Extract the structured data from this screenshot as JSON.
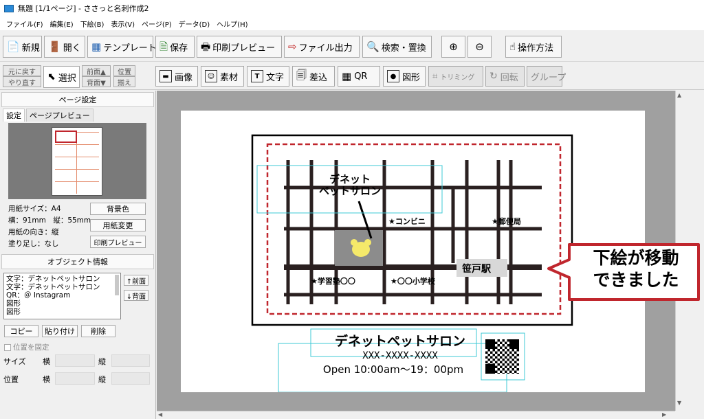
{
  "window": {
    "title": "無題 [1/1ページ] - ささっと名刺作成2"
  },
  "menu": [
    "ファイル(F)",
    "編集(E)",
    "下絵(B)",
    "表示(V)",
    "ページ(P)",
    "データ(D)",
    "ヘルプ(H)"
  ],
  "toolbar": {
    "new": "新規",
    "open": "開く",
    "template": "テンプレート",
    "save": "保存",
    "print_preview": "印刷プレビュー",
    "file_output": "ファイル出力",
    "search_replace": "検索・置換",
    "howto": "操作方法"
  },
  "toolbar2": {
    "undo": "元に戻す",
    "redo": "やり直す",
    "select": "選択",
    "front": "前面▲",
    "back": "背面▼",
    "align_top": "位置",
    "align_bottom": "揃え",
    "image": "画像",
    "material": "素材",
    "text": "文字",
    "merge": "差込",
    "qr": "QR",
    "shape": "図形",
    "trimming": "トリミング",
    "rotate": "回転",
    "group": "グループ"
  },
  "page_settings": {
    "header": "ページ設定",
    "tab_settings": "設定",
    "tab_preview": "ページプレビュー",
    "paper_size": "用紙サイズ：A4",
    "dims": "横：91mm　縦：55mm",
    "orientation": "用紙の向き：縦",
    "bleed": "塗り足し：なし",
    "bg_button": "背景色",
    "change_paper_button": "用紙変更",
    "print_preview_button": "印刷プレビュー"
  },
  "object_info": {
    "header": "オブジェクト情報",
    "items": [
      "文字：デネットペットサロン",
      "文字：デネットペットサロン",
      "QR：＠ Instagram",
      "図形",
      "図形"
    ],
    "front_button": "↑前面",
    "back_button": "↓背面",
    "copy_button": "コピー",
    "paste_button": "貼り付け",
    "delete_button": "削除",
    "lock_label": "位置を固定",
    "size_label": "サイズ",
    "pos_label": "位置",
    "w_label": "横",
    "h_label": "縦"
  },
  "canvas": {
    "map": {
      "salon_line1": "デネット",
      "salon_line2": "ペットサロン",
      "conbini": "★コンビニ",
      "post": "★郵便局",
      "station": "笹戸駅",
      "juku": "★学習塾〇〇",
      "school": "★〇〇小学校"
    },
    "callout_line1": "下絵が移動",
    "callout_line2": "できました",
    "card_title": "デネットペットサロン",
    "phone": "XXX-XXXX-XXXX",
    "hours": "Open 10:00am〜19：00pm"
  },
  "colors": {
    "accent_red": "#c0262d",
    "selection_cyan": "#3cc8d6",
    "pet_yellow": "#f5e96a"
  }
}
